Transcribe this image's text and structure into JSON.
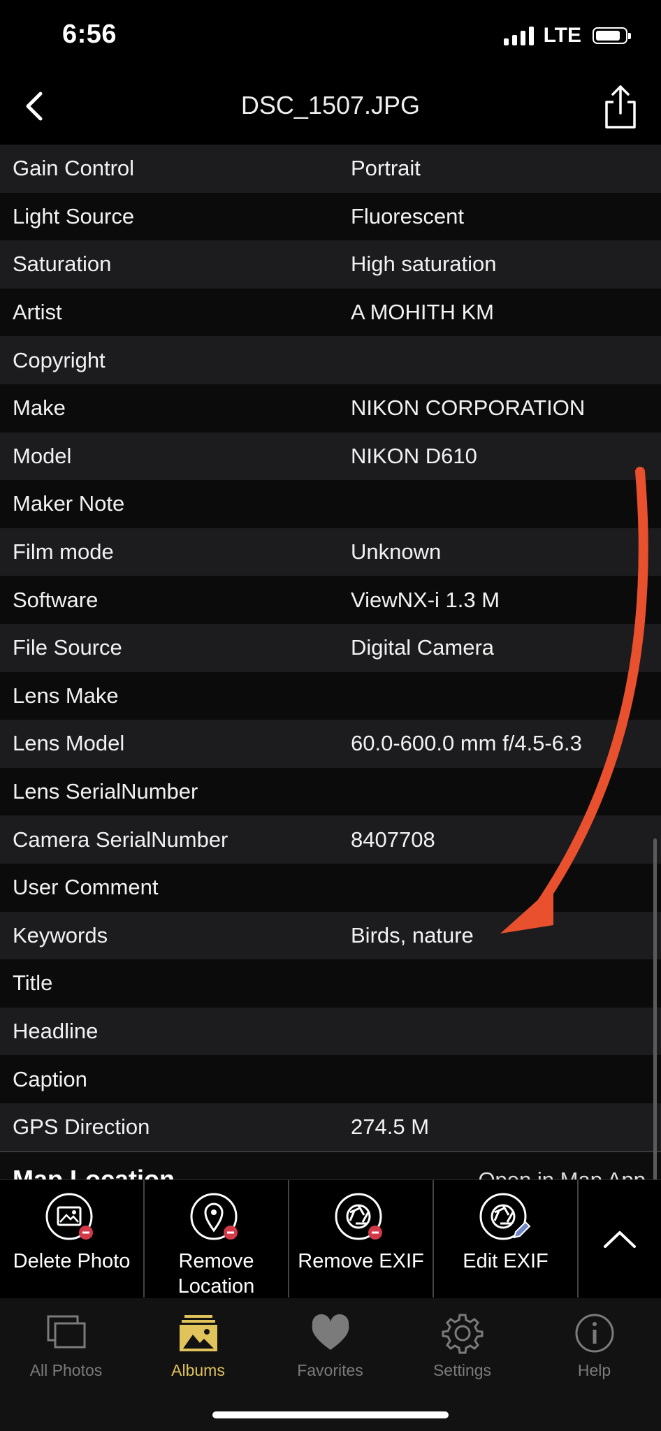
{
  "status": {
    "time": "6:56",
    "network": "LTE"
  },
  "header": {
    "title": "DSC_1507.JPG"
  },
  "rows": [
    {
      "label": "Gain Control",
      "value": "Portrait"
    },
    {
      "label": "Light Source",
      "value": "Fluorescent"
    },
    {
      "label": "Saturation",
      "value": "High saturation"
    },
    {
      "label": "Artist",
      "value": "A MOHITH KM"
    },
    {
      "label": "Copyright",
      "value": ""
    },
    {
      "label": "Make",
      "value": "NIKON CORPORATION"
    },
    {
      "label": "Model",
      "value": "NIKON D610"
    },
    {
      "label": "Maker Note",
      "value": ""
    },
    {
      "label": "Film mode",
      "value": "Unknown"
    },
    {
      "label": "Software",
      "value": "ViewNX-i 1.3 M"
    },
    {
      "label": "File Source",
      "value": "Digital Camera"
    },
    {
      "label": "Lens Make",
      "value": ""
    },
    {
      "label": "Lens Model",
      "value": "60.0-600.0 mm f/4.5-6.3"
    },
    {
      "label": "Lens SerialNumber",
      "value": ""
    },
    {
      "label": "Camera SerialNumber",
      "value": "8407708"
    },
    {
      "label": "User Comment",
      "value": ""
    },
    {
      "label": "Keywords",
      "value": "Birds, nature"
    },
    {
      "label": "Title",
      "value": ""
    },
    {
      "label": "Headline",
      "value": ""
    },
    {
      "label": "Caption",
      "value": ""
    },
    {
      "label": "GPS Direction",
      "value": "274.5 M"
    }
  ],
  "map": {
    "label": "Map Location",
    "link": "Open in Map App"
  },
  "actions": {
    "delete_photo": "Delete Photo",
    "remove_location": "Remove\nLocation",
    "remove_exif": "Remove EXIF",
    "edit_exif": "Edit EXIF"
  },
  "tabs": {
    "all_photos": "All Photos",
    "albums": "Albums",
    "favorites": "Favorites",
    "settings": "Settings",
    "help": "Help"
  },
  "colors": {
    "accent": "#e0c35a",
    "arrow": "#e8502e",
    "badge": "#d23a4a"
  }
}
